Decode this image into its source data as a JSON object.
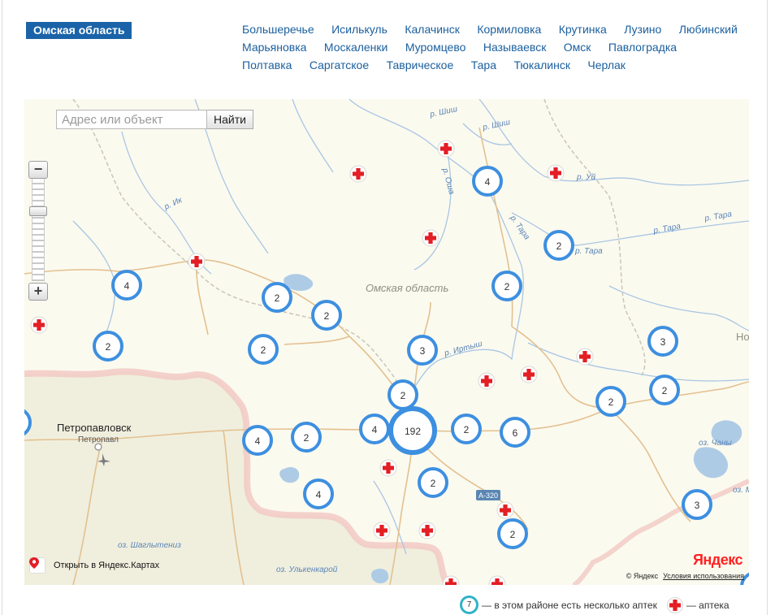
{
  "header": {
    "region_label": "Омская область",
    "city_rows": [
      [
        "Большеречье",
        "Исилькуль",
        "Калачинск",
        "Кормиловка",
        "Крутинка",
        "Лузино",
        "Любинский"
      ],
      [
        "Марьяновка",
        "Москаленки",
        "Муромцево",
        "Называевск",
        "Омск",
        "Павлоградка"
      ],
      [
        "Полтавка",
        "Саргатское",
        "Таврическое",
        "Тара",
        "Тюкалинск",
        "Черлак"
      ]
    ]
  },
  "map": {
    "search": {
      "placeholder": "Адрес или объект",
      "button": "Найти"
    },
    "zoom": {
      "plus": "+",
      "minus": "−"
    },
    "open_in_maps": "Открыть в Яндекс.Картах",
    "logo": "Яндекс",
    "copyright": "© Яндекс",
    "terms": "Условия использования",
    "region_name": "Омская область",
    "city_label": "Петропавловск",
    "city_sublabel": "Петропавл",
    "road_label": "А-320",
    "river_labels": [
      "р. Шиш",
      "р. Шиш",
      "р. Оша",
      "р. Ик",
      "р. Уй",
      "р. Тара",
      "р. Тара",
      "р. Тара",
      "р. Тара",
      "р. Иртыш"
    ],
    "lake_labels": [
      "оз. Шаглытениз",
      "оз. Улькенкарой",
      "оз. Чаны",
      "оз. Ма"
    ],
    "edge_label": "Но",
    "cluster_counts": [
      "4",
      "2",
      "4",
      "2",
      "2",
      "2",
      "2",
      "2",
      "3",
      "3",
      "2",
      "2",
      "2",
      "4",
      "192",
      "2",
      "6",
      "2",
      "4",
      "3",
      "4",
      "2",
      "2"
    ],
    "pharmacy_count": 15,
    "colors": {
      "cluster": "#3d8fe0",
      "pharmacy": "#e31e24",
      "region_badge": "#1a63a8",
      "link": "#1b5f9e"
    }
  },
  "legend": {
    "cluster_number": "7",
    "cluster_text": "— в этом районе есть несколько аптек",
    "pharmacy_text": "— аптека",
    "cluster_color": "#2fb3c8"
  }
}
